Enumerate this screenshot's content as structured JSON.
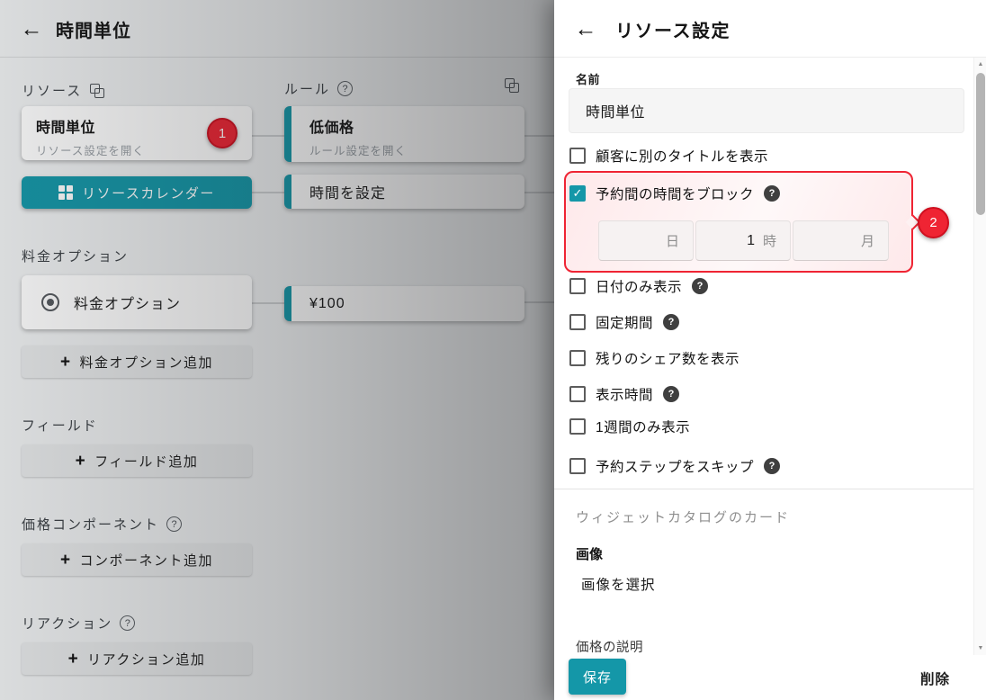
{
  "colors": {
    "accent_teal": "#1497a8",
    "annotation_red": "#ef2433"
  },
  "icons": {
    "back": "←",
    "plus": "+",
    "check": "✓",
    "help": "?",
    "scroll_up": "▲",
    "scroll_down": "▼",
    "copy": "copy-icon",
    "radio": "radio-selected-icon",
    "grid": "grid-icon"
  },
  "left": {
    "header": {
      "title": "時間単位"
    },
    "resource_section": {
      "label": "リソース",
      "card": {
        "title": "時間単位",
        "subtitle": "リソース設定を開く",
        "badge": "1"
      },
      "calendar_button": "リソースカレンダー"
    },
    "rules_section": {
      "label": "ルール",
      "card_low_price": {
        "title": "低価格",
        "subtitle": "ルール設定を開く"
      },
      "card_set_time": {
        "title": "時間を設定"
      },
      "card_price": {
        "title": "¥100"
      }
    },
    "price_options_section": {
      "label": "料金オプション",
      "card_title": "料金オプション",
      "add_button": "料金オプション追加"
    },
    "fields_section": {
      "label": "フィールド",
      "add_button": "フィールド追加"
    },
    "components_section": {
      "label": "価格コンポーネント",
      "add_button": "コンポーネント追加"
    },
    "reactions_section": {
      "label": "リアクション",
      "add_button": "リアクション追加"
    }
  },
  "panel": {
    "title": "リソース設定",
    "name_label": "名前",
    "name_value": "時間単位",
    "checkboxes": [
      {
        "label": "顧客に別のタイトルを表示",
        "checked": false
      },
      {
        "label": "予約間の時間をブロック",
        "checked": true
      },
      {
        "label": "日付のみ表示",
        "checked": false
      },
      {
        "label": "固定期間",
        "checked": false
      },
      {
        "label": "残りのシェア数を表示",
        "checked": false
      },
      {
        "label": "表示時間",
        "checked": false
      },
      {
        "label": "1週間のみ表示",
        "checked": false
      },
      {
        "label": "予約ステップをスキップ",
        "checked": false
      }
    ],
    "block_fields": [
      {
        "value": "",
        "suffix": "日"
      },
      {
        "value": "1",
        "suffix": "時"
      },
      {
        "value": "",
        "suffix": "月"
      }
    ],
    "annotation_badge": "2",
    "widget_catalog_label": "ウィジェットカタログのカード",
    "image_label": "画像",
    "image_select": "画像を選択",
    "price_description_label": "価格の説明",
    "save_button": "保存",
    "delete_button": "削除"
  }
}
